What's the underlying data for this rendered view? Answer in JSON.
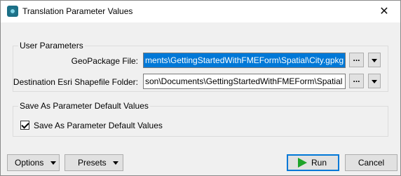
{
  "window": {
    "title": "Translation Parameter Values",
    "close_glyph": "✕"
  },
  "user_parameters": {
    "group_title": "User Parameters",
    "geopackage": {
      "label": "GeoPackage File:",
      "value": "ments\\GettingStartedWithFMEForm\\Spatial\\City.gpkg",
      "browse_label": "..."
    },
    "shapefile_folder": {
      "label": "Destination Esri Shapefile Folder:",
      "value": "son\\Documents\\GettingStartedWithFMEForm\\Spatial",
      "browse_label": "..."
    }
  },
  "defaults": {
    "group_title": "Save As Parameter Default Values",
    "checkbox_label": "Save As Parameter Default Values",
    "checked": true
  },
  "footer": {
    "options_label": "Options",
    "presets_label": "Presets",
    "run_label": "Run",
    "cancel_label": "Cancel"
  },
  "colors": {
    "selection": "#0078d7",
    "run_icon": "#1ea32a",
    "window_bg": "#f0f0f0"
  }
}
